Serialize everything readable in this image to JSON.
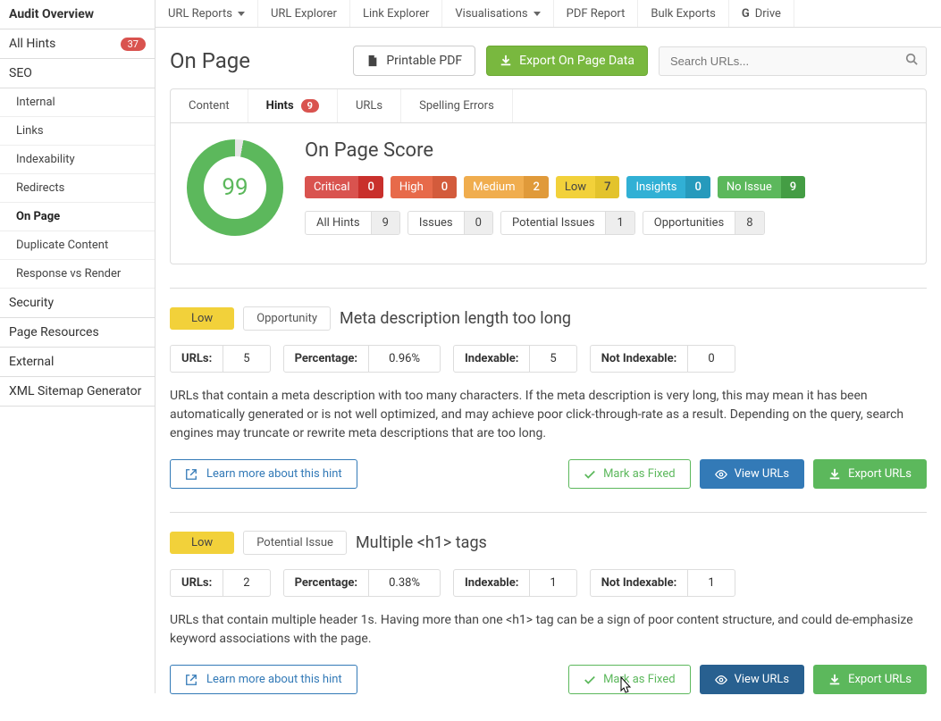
{
  "topnav": [
    "URL Reports",
    "URL Explorer",
    "Link Explorer",
    "Visualisations",
    "PDF Report",
    "Bulk Exports",
    "Drive"
  ],
  "sidebar": {
    "audit_overview": "Audit Overview",
    "all_hints": "All Hints",
    "all_hints_count": 37,
    "seo": "SEO",
    "seo_items": [
      "Internal",
      "Links",
      "Indexability",
      "Redirects",
      "On Page",
      "Duplicate Content",
      "Response vs Render"
    ],
    "security": "Security",
    "page_resources": "Page Resources",
    "external": "External",
    "xml_sitemap": "XML Sitemap Generator"
  },
  "page": {
    "title": "On Page",
    "printable": "Printable PDF",
    "export": "Export On Page Data",
    "search_placeholder": "Search URLs..."
  },
  "tabs": [
    "Content",
    "Hints",
    "URLs",
    "Spelling Errors"
  ],
  "tabs_hints_badge": 9,
  "score": {
    "title": "On Page Score",
    "value": 99,
    "severity": [
      {
        "label": "Critical",
        "count": 0,
        "cls": "p-critical"
      },
      {
        "label": "High",
        "count": 0,
        "cls": "p-high"
      },
      {
        "label": "Medium",
        "count": 2,
        "cls": "p-medium"
      },
      {
        "label": "Low",
        "count": 7,
        "cls": "p-low"
      },
      {
        "label": "Insights",
        "count": 0,
        "cls": "p-insights"
      },
      {
        "label": "No Issue",
        "count": 9,
        "cls": "p-noissue"
      }
    ],
    "groups": [
      {
        "label": "All Hints",
        "count": 9
      },
      {
        "label": "Issues",
        "count": 0
      },
      {
        "label": "Potential Issues",
        "count": 1
      },
      {
        "label": "Opportunities",
        "count": 8
      }
    ]
  },
  "hints": [
    {
      "severity": "Low",
      "type": "Opportunity",
      "title": "Meta description length too long",
      "stats": {
        "urls": 5,
        "percentage": "0.96%",
        "indexable": 5,
        "not_indexable": 0
      },
      "desc": "URLs that contain a meta description with too many characters. If the meta description is very long, this may mean it has been automatically generated or is not well optimized, and may achieve poor click-through-rate as a result. Depending on the query, search engines may truncate or rewrite meta descriptions that are too long."
    },
    {
      "severity": "Low",
      "type": "Potential Issue",
      "title": "Multiple <h1> tags",
      "stats": {
        "urls": 2,
        "percentage": "0.38%",
        "indexable": 1,
        "not_indexable": 1
      },
      "desc": "URLs that contain multiple header 1s. Having more than one <h1> tag can be a sign of poor content structure, and could de-emphasize keyword associations with the page."
    }
  ],
  "labels": {
    "urls": "URLs:",
    "percentage": "Percentage:",
    "indexable": "Indexable:",
    "not_indexable": "Not Indexable:",
    "learn": "Learn more about this hint",
    "fixed": "Mark as Fixed",
    "view": "View URLs",
    "export": "Export URLs"
  }
}
